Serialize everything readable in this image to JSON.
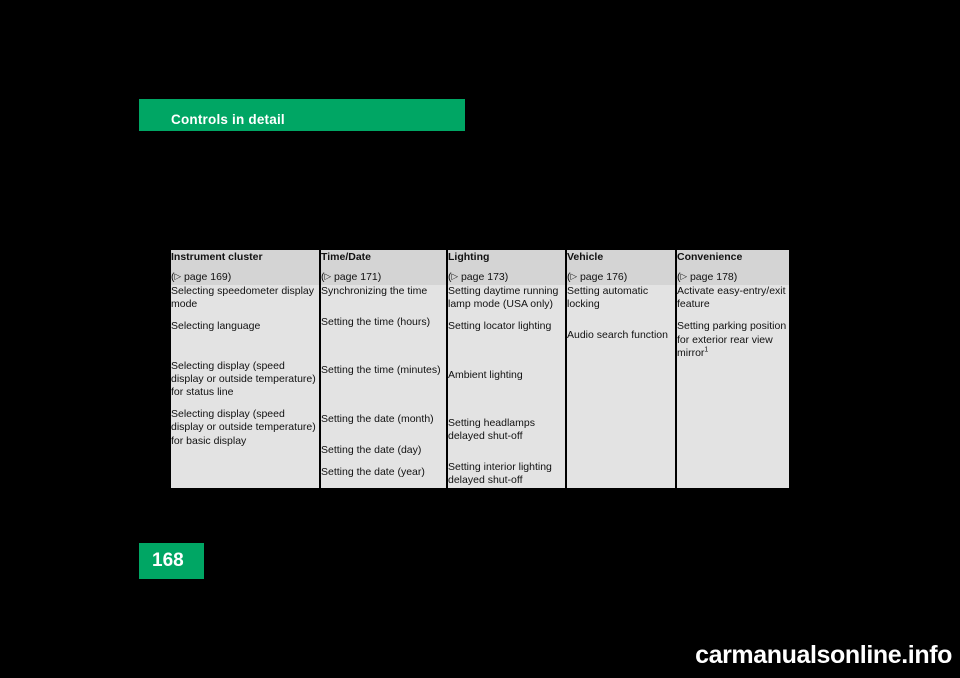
{
  "header": {
    "title": "Controls in detail",
    "bar_color": "#00a664"
  },
  "page": {
    "number": "168"
  },
  "watermark": {
    "text": "carmanualsonline.info"
  },
  "table": {
    "triangle_glyph": "▷",
    "columns": [
      {
        "title": "Instrument cluster",
        "ref": "page 169",
        "items": [
          "Selecting speedometer display mode",
          "Selecting language",
          "Selecting display (speed display or outside temperature) for status line",
          "Selecting display (speed display or outside temperature) for basic display"
        ]
      },
      {
        "title": "Time/Date",
        "ref": "page 171",
        "items": [
          "Synchronizing the time",
          "Setting the time (hours)",
          "Setting the time (minutes)",
          "Setting the date (month)",
          "Setting the date (day)",
          "Setting the date (year)"
        ]
      },
      {
        "title": "Lighting",
        "ref": "page 173",
        "items": [
          "Setting daytime running lamp mode (USA only)",
          "Setting locator lighting",
          "Ambient lighting",
          "Setting headlamps delayed shut-off",
          "Setting interior lighting delayed shut-off"
        ]
      },
      {
        "title": "Vehicle",
        "ref": "page 176",
        "items": [
          "Setting automatic locking",
          "Audio search function"
        ]
      },
      {
        "title": "Convenience",
        "ref": "page 178",
        "items": [
          "Activate easy-entry/exit feature",
          "Setting parking position for exterior rear view mirror"
        ],
        "footnote_marker": "1"
      }
    ]
  }
}
